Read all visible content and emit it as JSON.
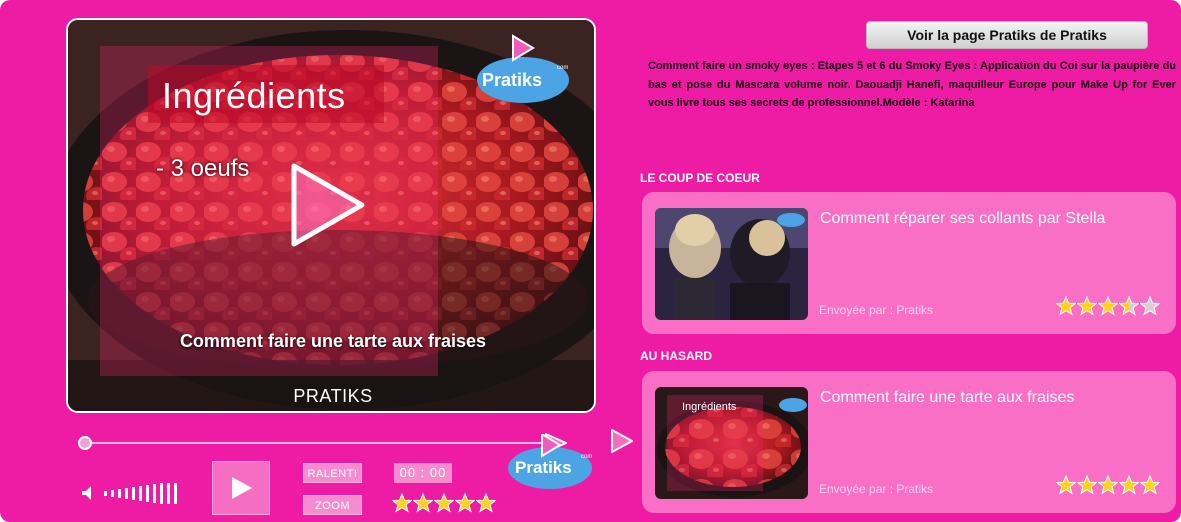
{
  "video": {
    "overlay_title": "Ingrédients",
    "overlay_text": "- 3 oeufs",
    "caption": "Comment faire une tarte aux fraises",
    "brand": "PRATIKS",
    "logo_text": "Pratiks",
    "logo_sub": "com",
    "play_icon": "play-icon"
  },
  "controls": {
    "ralenti_label": "RALENTI",
    "zoom_label": "ZOOM",
    "timecode": "00 : 00",
    "rating": 5,
    "logo_text": "Pratiks",
    "logo_sub": "com"
  },
  "sidebar": {
    "page_button": "Voir la page Pratiks de Pratiks",
    "description": "Comment faire un smoky eyes : Etapes 5 et 6 du Smoky Eyes : Application du Coi sur la paupière du bas et pose du Mascara volume noir.  Daouadji Hanefi, maquilleur Europe pour Make Up for Ever vous livre tous ses secrets de professionnel.Modèle : Katarina",
    "coup_de_coeur_heading": "LE COUP DE COEUR",
    "hasard_heading": "AU HASARD",
    "cards": [
      {
        "title": "Comment réparer ses collants par Stella",
        "by": "Envoyée par : Pratiks",
        "rating": 3.5
      },
      {
        "title": "Comment faire une tarte aux fraises",
        "by": "Envoyée par : Pratiks",
        "rating": 5,
        "thumb_text": "Ingrédients"
      }
    ]
  },
  "colors": {
    "background": "#ee1ca5",
    "card": "#f96fc6",
    "star": "#ffd21e"
  }
}
